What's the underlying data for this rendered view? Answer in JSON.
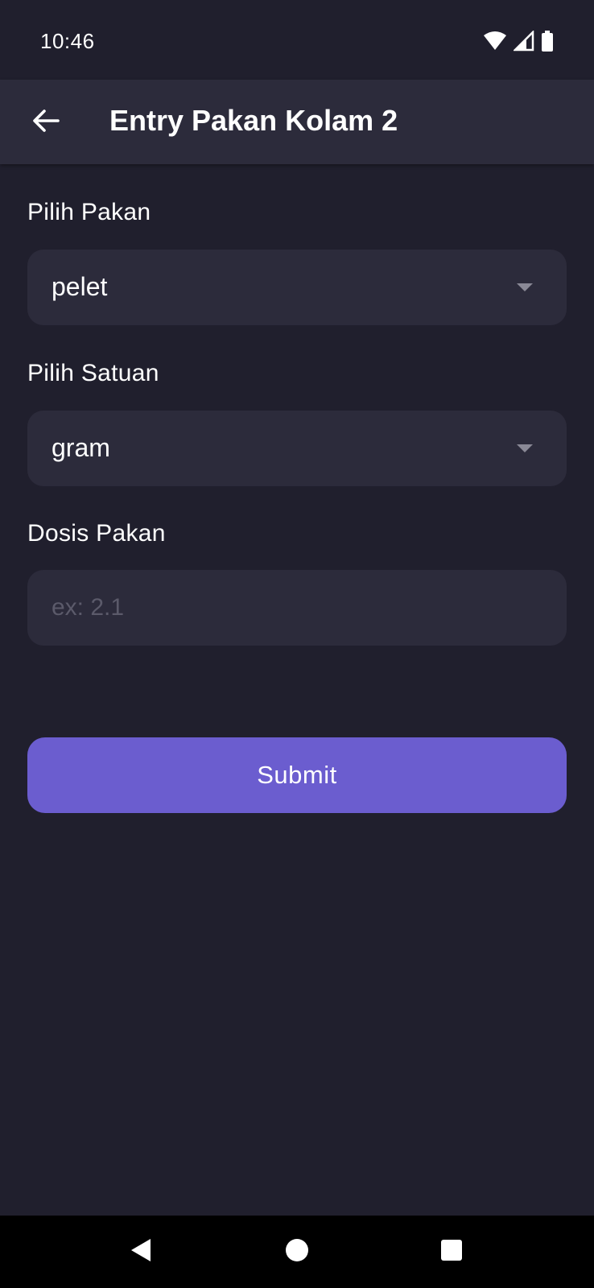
{
  "status_bar": {
    "time": "10:46",
    "icons": [
      "wifi-icon",
      "cellular-signal-icon",
      "battery-icon"
    ]
  },
  "app_bar": {
    "back_icon": "arrow-back-icon",
    "title": "Entry Pakan Kolam 2"
  },
  "form": {
    "feed_label": "Pilih Pakan",
    "feed_value": "pelet",
    "unit_label": "Pilih Satuan",
    "unit_value": "gram",
    "dose_label": "Dosis Pakan",
    "dose_placeholder": "ex: 2.1",
    "dose_value": ""
  },
  "submit_label": "Submit",
  "nav_bar": {
    "icons": [
      "back-triangle-icon",
      "home-circle-icon",
      "recents-square-icon"
    ]
  },
  "colors": {
    "background": "#201f2d",
    "surface": "#2c2b3b",
    "accent": "#6b5dcf",
    "placeholder": "#5b5a6a"
  }
}
